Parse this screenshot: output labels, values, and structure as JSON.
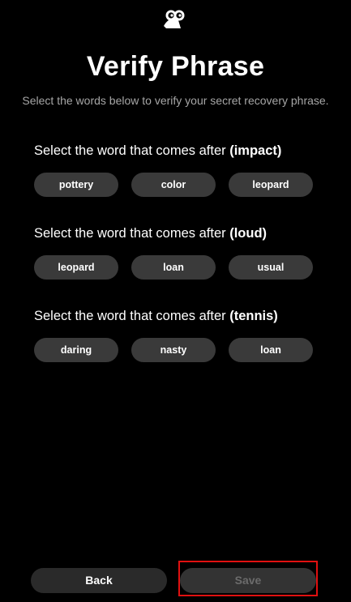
{
  "header": {
    "logo_icon": "owl-logo-icon",
    "title": "Verify Phrase",
    "subtitle": "Select the words below to verify your secret recovery phrase."
  },
  "questions": [
    {
      "prefix": "Select the word that comes after ",
      "keyword": "(impact)",
      "options": [
        "pottery",
        "color",
        "leopard"
      ]
    },
    {
      "prefix": "Select the word that comes after ",
      "keyword": "(loud)",
      "options": [
        "leopard",
        "loan",
        "usual"
      ]
    },
    {
      "prefix": "Select the word that comes after ",
      "keyword": "(tennis)",
      "options": [
        "daring",
        "nasty",
        "loan"
      ]
    }
  ],
  "footer": {
    "back_label": "Back",
    "save_label": "Save",
    "save_enabled": false,
    "highlight_color": "#e01010"
  },
  "colors": {
    "background": "#000000",
    "chip": "#3a3a3a",
    "subtitle": "#a6a6a6",
    "disabled_text": "#6b6b6b"
  }
}
